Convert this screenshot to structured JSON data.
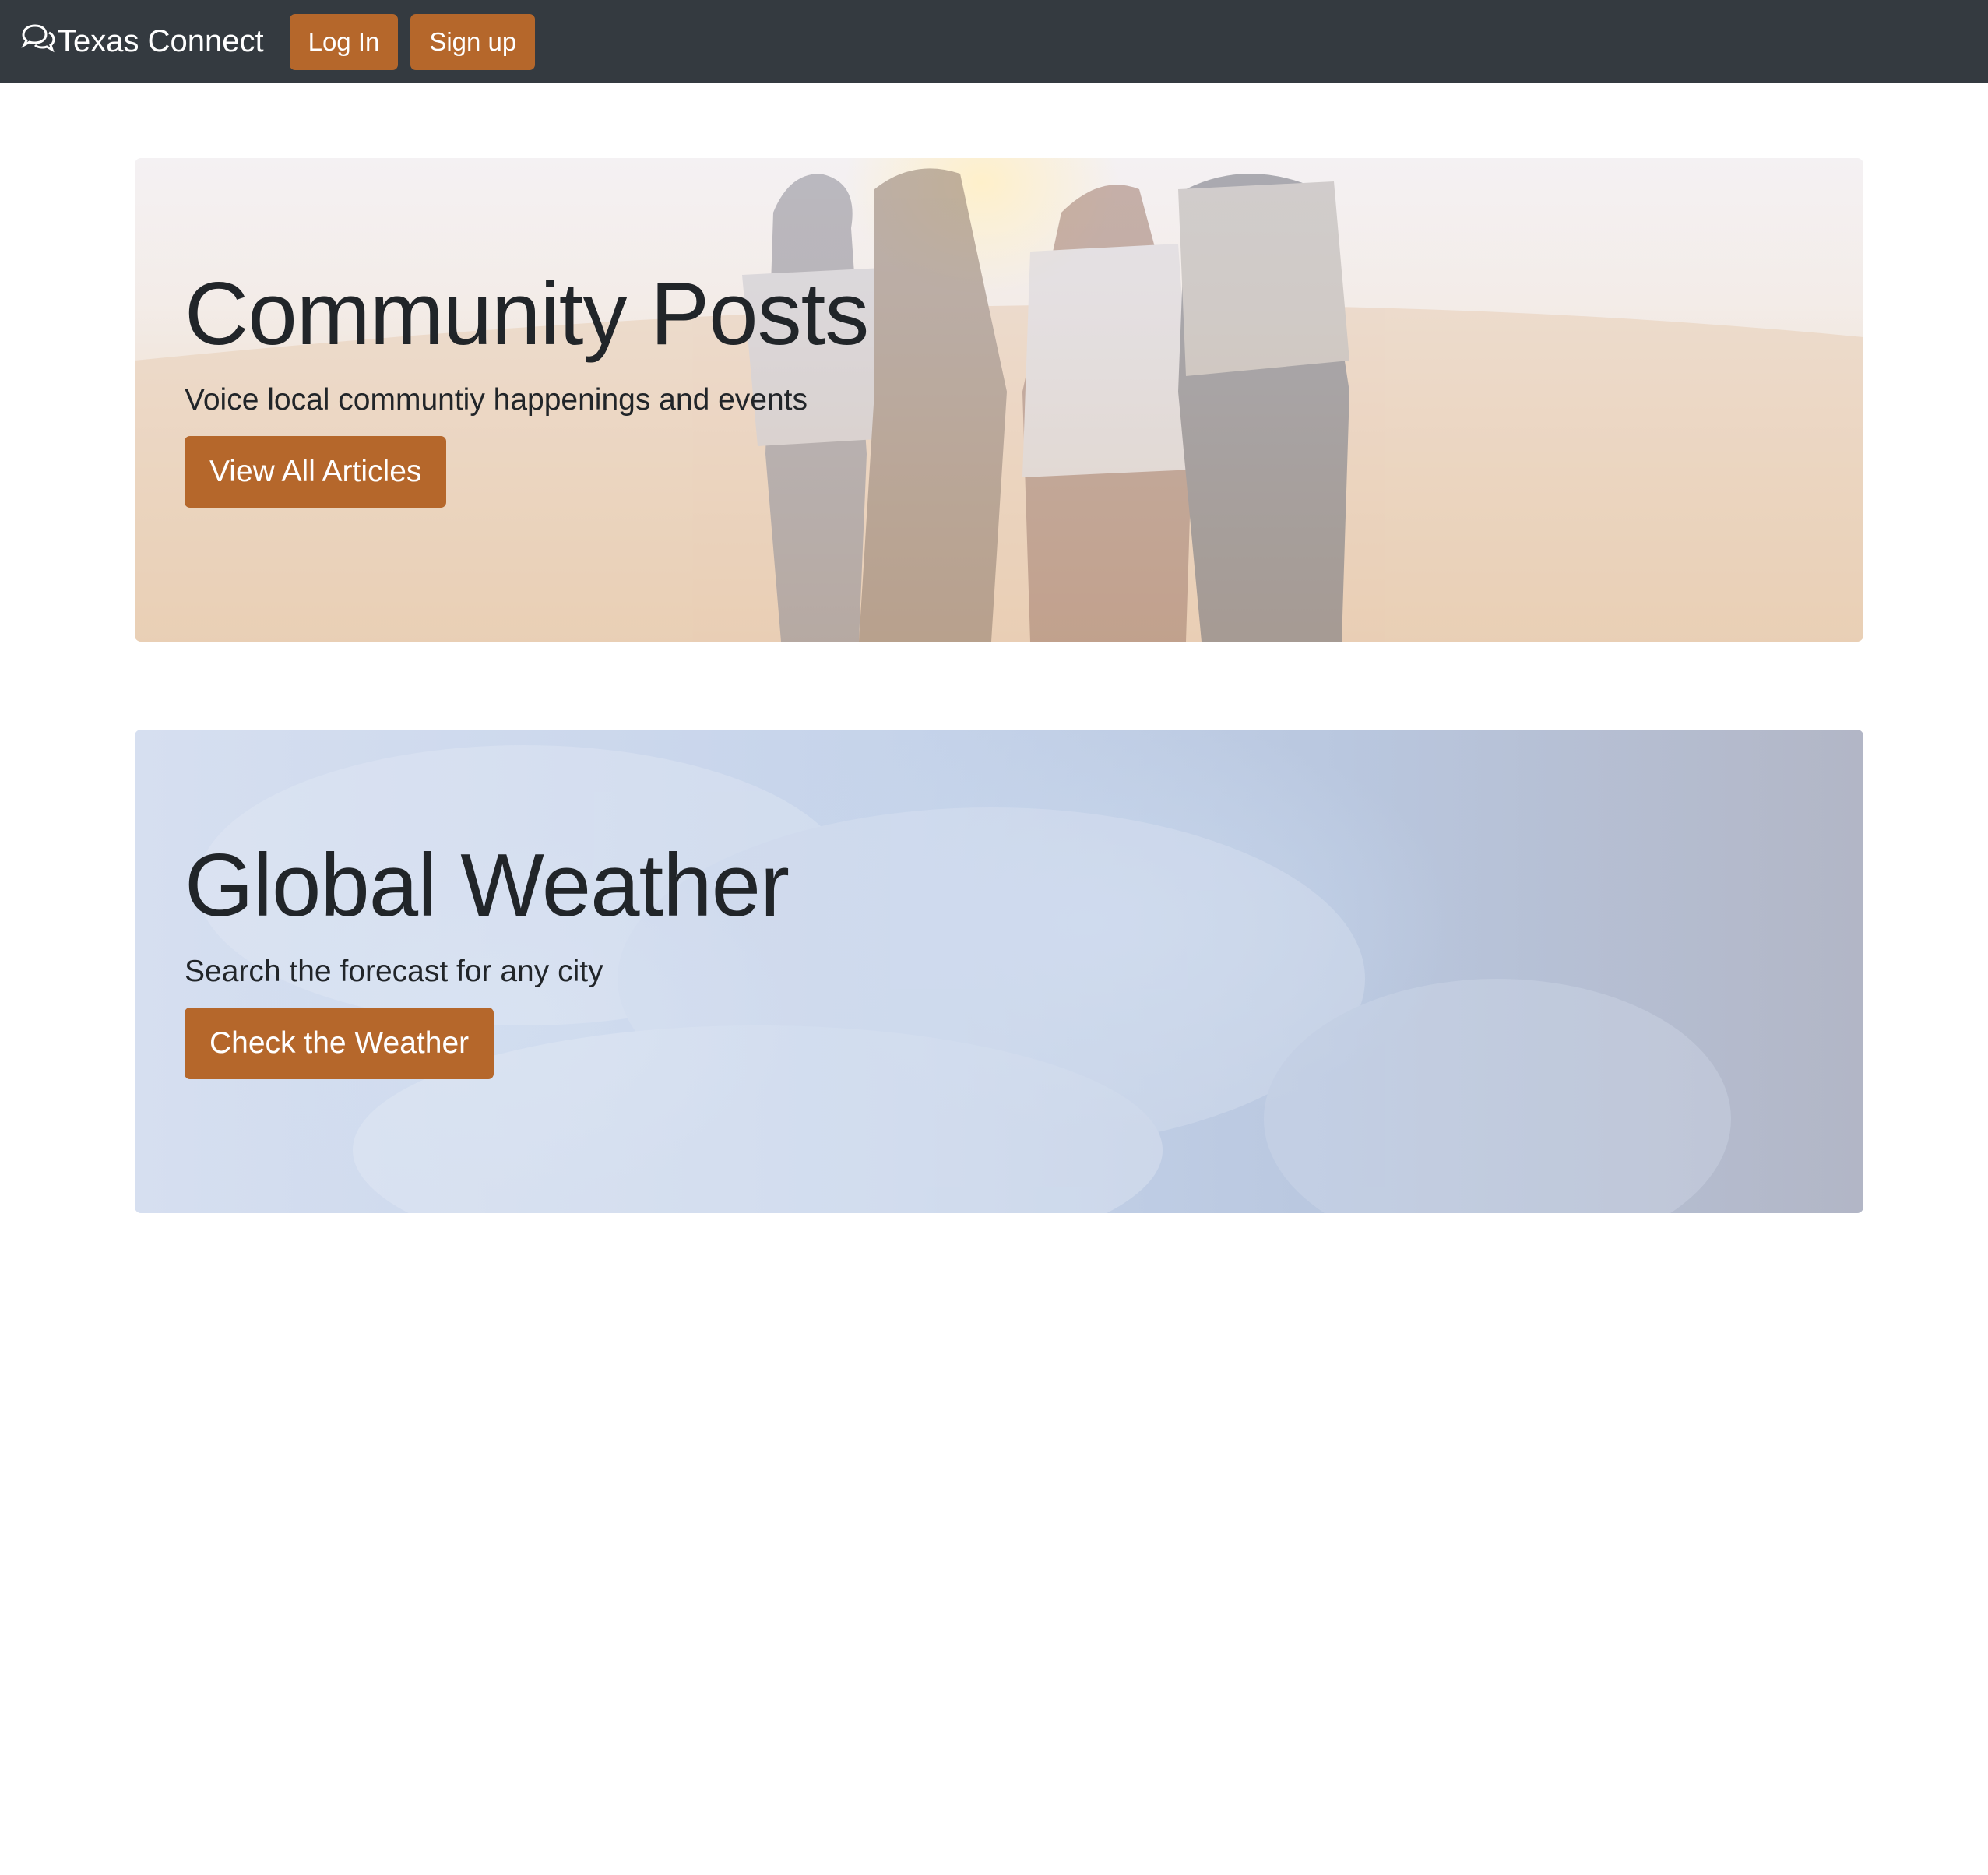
{
  "navbar": {
    "brand": "Texas Connect",
    "brand_icon": "chat-bubbles-icon",
    "login_label": "Log In",
    "signup_label": "Sign up",
    "bg_color": "#343a40",
    "button_color": "#b5672b"
  },
  "community": {
    "title": "Community Posts",
    "lead": "Voice local communtiy happenings and events",
    "button_label": "View All Articles"
  },
  "weather": {
    "title": "Global Weather",
    "lead": "Search the forecast for any city",
    "button_label": "Check the Weather"
  }
}
